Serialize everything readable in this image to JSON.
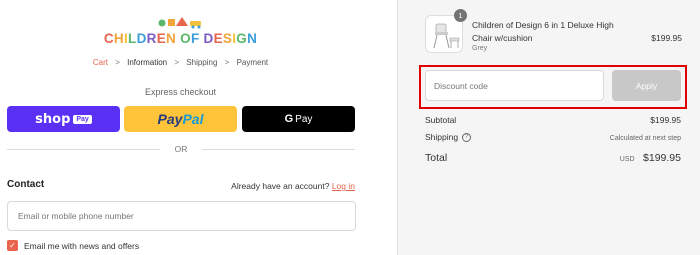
{
  "brand": {
    "logo_letters": [
      "C",
      "H",
      "I",
      "L",
      "D",
      "R",
      "E",
      "N",
      " ",
      "O",
      "F",
      " ",
      "D",
      "E",
      "S",
      "I",
      "G",
      "N"
    ],
    "logo_colors": [
      "#e8644d",
      "#f2a33a",
      "#f2c23a",
      "#5bb86b",
      "#3a9fd8",
      "#7c5cc4",
      "#e8644d",
      "#f2a33a",
      "#ffffff",
      "#5bb86b",
      "#3a9fd8",
      "#ffffff",
      "#7c5cc4",
      "#e8644d",
      "#f2a33a",
      "#f2c23a",
      "#5bb86b",
      "#3a9fd8"
    ]
  },
  "breadcrumb": {
    "cart": "Cart",
    "information": "Information",
    "shipping": "Shipping",
    "payment": "Payment",
    "separator": ">"
  },
  "express": {
    "label": "Express checkout",
    "shop_word": "shop",
    "shop_chip": "Pay",
    "paypal_1": "Pay",
    "paypal_2": "Pal",
    "gpay_letter": "G",
    "gpay_text": "Pay"
  },
  "divider": {
    "or": "OR"
  },
  "contact": {
    "heading": "Contact",
    "account_prompt": "Already have an account?",
    "login_link": "Log in",
    "email_placeholder": "Email or mobile phone number",
    "newsletter_label": "Email me with news and offers",
    "newsletter_checked": true
  },
  "order": {
    "product": {
      "quantity": "1",
      "name": "Children of Design 6 in 1 Deluxe High Chair w/cushion",
      "variant": "Grey",
      "price": "$199.95"
    },
    "discount": {
      "placeholder": "Discount code",
      "apply_label": "Apply"
    },
    "subtotal_label": "Subtotal",
    "subtotal_value": "$199.95",
    "shipping_label": "Shipping",
    "shipping_value": "Calculated at next step",
    "total_label": "Total",
    "currency": "USD",
    "total_value": "$199.95"
  },
  "colors": {
    "accent": "#e8644d",
    "highlight": "#e00000",
    "shop_pay": "#5a31f4",
    "paypal": "#ffc439"
  }
}
